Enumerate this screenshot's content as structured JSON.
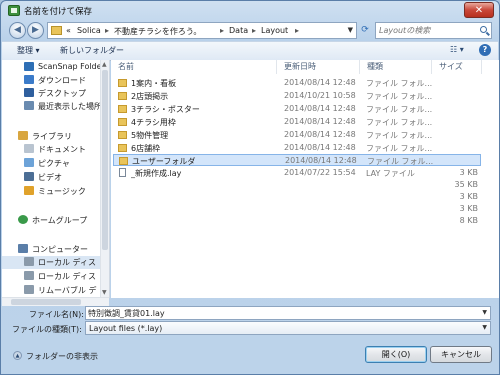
{
  "window": {
    "title": "名前を付けて保存",
    "close_label": "✕"
  },
  "address": {
    "crumbs": [
      "«",
      "Solica",
      "不動産チラシを作ろう。",
      "Data",
      "Layout"
    ],
    "separators": [
      "▸",
      "▸",
      "▸",
      "▸"
    ],
    "refresh_icon": "refresh-icon",
    "search_placeholder": "Layoutの検索"
  },
  "toolbar": {
    "organize_label": "整理 ▾",
    "new_folder_label": "新しいフォルダー",
    "view_label": "☷ ▾",
    "help_label": "?"
  },
  "sidebar": {
    "items": [
      {
        "label": "ScanSnap Folde",
        "icon": "scansnap-icon",
        "color": "#2e6fb5"
      },
      {
        "label": "ダウンロード",
        "icon": "download-icon",
        "color": "#3b7bc9"
      },
      {
        "label": "デスクトップ",
        "icon": "desktop-icon",
        "color": "#2f5f9e"
      },
      {
        "label": "最近表示した場所",
        "icon": "recent-places-icon",
        "color": "#6a8bb0"
      },
      {
        "label": "ライブラリ",
        "icon": "library-icon",
        "color": "#d8a640"
      },
      {
        "label": "ドキュメント",
        "icon": "documents-icon",
        "color": "#b9c4d0"
      },
      {
        "label": "ピクチャ",
        "icon": "pictures-icon",
        "color": "#6da3d8"
      },
      {
        "label": "ビデオ",
        "icon": "videos-icon",
        "color": "#4c6e95"
      },
      {
        "label": "ミュージック",
        "icon": "music-icon",
        "color": "#e0a22b"
      },
      {
        "label": "ホームグループ",
        "icon": "homegroup-icon",
        "color": "#3a9a4a"
      },
      {
        "label": "コンピューター",
        "icon": "computer-icon",
        "color": "#5a7ea8"
      },
      {
        "label": "ローカル ディス",
        "icon": "local-disk-icon",
        "color": "#8a9aaa"
      },
      {
        "label": "ローカル ディス",
        "icon": "local-disk-icon",
        "color": "#8a9aaa"
      },
      {
        "label": "リムーバブル デ",
        "icon": "removable-disk-icon",
        "color": "#8a9aaa"
      }
    ]
  },
  "file_list": {
    "columns": [
      "名前",
      "更新日時",
      "種類",
      "サイズ"
    ],
    "rows": [
      {
        "name": "1案内・看板",
        "date": "2014/08/14 12:48",
        "type": "ファイル フォル...",
        "size": "",
        "kind": "folder"
      },
      {
        "name": "2店頭掲示",
        "date": "2014/10/21 10:58",
        "type": "ファイル フォル...",
        "size": "",
        "kind": "folder"
      },
      {
        "name": "3チラシ・ポスター",
        "date": "2014/08/14 12:48",
        "type": "ファイル フォル...",
        "size": "",
        "kind": "folder"
      },
      {
        "name": "4チラシ用枠",
        "date": "2014/08/14 12:48",
        "type": "ファイル フォル...",
        "size": "",
        "kind": "folder"
      },
      {
        "name": "5物件管理",
        "date": "2014/08/14 12:48",
        "type": "ファイル フォル...",
        "size": "",
        "kind": "folder"
      },
      {
        "name": "6店舗枠",
        "date": "2014/08/14 12:48",
        "type": "ファイル フォル...",
        "size": "",
        "kind": "folder"
      },
      {
        "name": "ユーザーフォルダ",
        "date": "2014/08/14 12:48",
        "type": "ファイル フォル...",
        "size": "",
        "kind": "folder",
        "selected": true
      },
      {
        "name": "_新規作成.lay",
        "date": "2014/07/22 15:54",
        "type": "LAY ファイル",
        "size": "3 KB",
        "kind": "file"
      },
      {
        "name": "",
        "date": "",
        "type": "",
        "size": "35 KB",
        "kind": "none"
      },
      {
        "name": "",
        "date": "",
        "type": "",
        "size": "3 KB",
        "kind": "none"
      },
      {
        "name": "",
        "date": "",
        "type": "",
        "size": "3 KB",
        "kind": "none"
      },
      {
        "name": "",
        "date": "",
        "type": "",
        "size": "8 KB",
        "kind": "none"
      }
    ]
  },
  "form": {
    "filename_label": "ファイル名(N):",
    "filename_value": "特別徴調_賃貸01.lay",
    "filetype_label": "ファイルの種類(T):",
    "filetype_value": "Layout files (*.lay)"
  },
  "footer": {
    "hide_folders_label": "フォルダーの非表示",
    "open_label": "開く(O)",
    "cancel_label": "キャンセル"
  }
}
